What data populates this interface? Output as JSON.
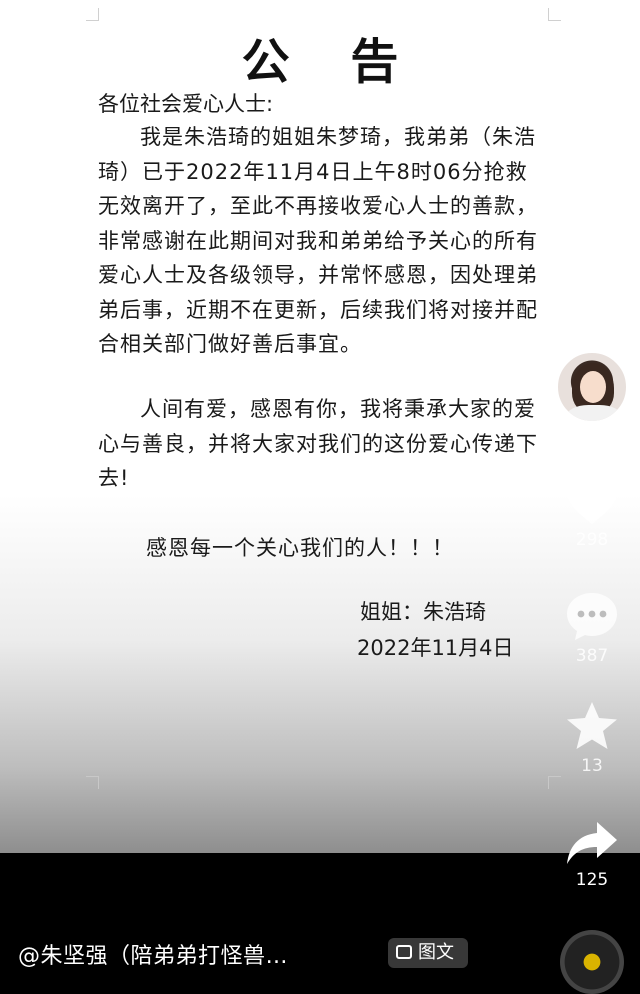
{
  "notice": {
    "title": "公 告",
    "salutation": "各位社会爱心人士:",
    "paragraph1": "我是朱浩琦的姐姐朱梦琦，我弟弟（朱浩琦）已于2022年11月4日上午8时06分抢救无效离开了，至此不再接收爱心人士的善款，非常感谢在此期间对我和弟弟给予关心的所有爱心人士及各级领导，并常怀感恩，因处理弟弟后事，近期不在更新，后续我们将对接并配合相关部门做好善后事宜。",
    "paragraph2": "人间有爱，感恩有你，我将秉承大家的爱心与善良，并将大家对我们的这份爱心传递下去!",
    "thanks": "感恩每一个关心我们的人！！！",
    "signature": "姐姐：朱浩琦",
    "date": "2022年11月4日"
  },
  "sidebar": {
    "avatar_icon": "user-avatar",
    "like_icon": "heart-icon",
    "like_count": "298",
    "comment_icon": "comment-icon",
    "comment_count": "387",
    "favorite_icon": "star-icon",
    "favorite_count": "13",
    "share_icon": "share-arrow-icon",
    "share_count": "125"
  },
  "footer": {
    "author_title": "@朱坚强（陪弟弟打怪兽…",
    "post_type_label": "图文",
    "post_type_icon": "image-text-icon",
    "music_icon": "music-disc-icon"
  },
  "colors": {
    "background": "#000000",
    "document": "#ffffff",
    "icon_fill": "#ffffff"
  }
}
